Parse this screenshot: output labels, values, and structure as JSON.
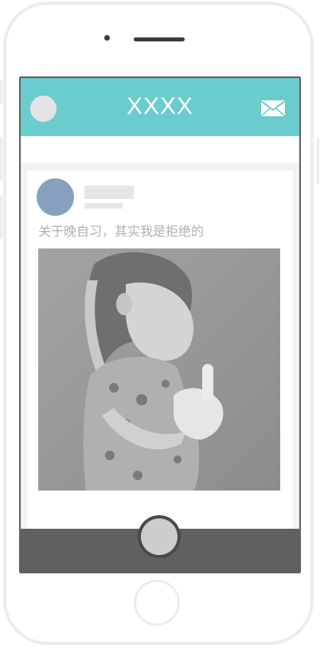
{
  "header": {
    "title": "XXXX"
  },
  "post": {
    "text": "关于晚自习，其实我是拒绝的"
  },
  "icons": {
    "profile": "avatar",
    "mail": "mail-icon",
    "fab": "compose-button",
    "home": "home-button"
  },
  "colors": {
    "header": "#6acccc",
    "bottom_bar": "#606060",
    "avatar": "#87a0bd"
  }
}
